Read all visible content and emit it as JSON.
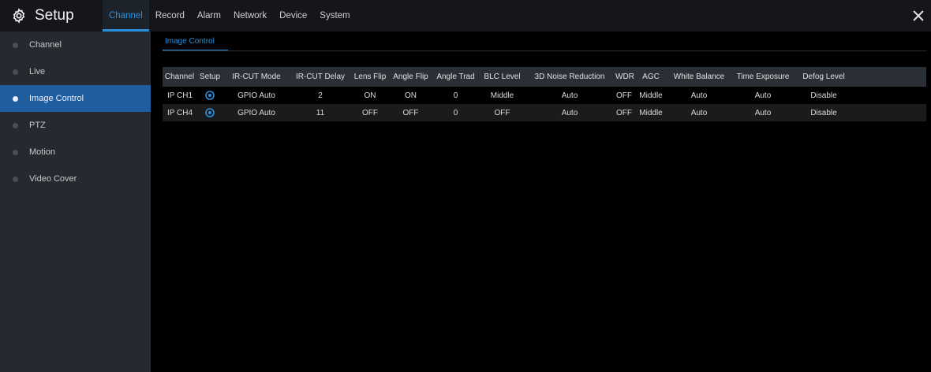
{
  "header": {
    "title": "Setup",
    "logo_icon": "gear-icon",
    "close_icon": "close-icon",
    "nav": [
      {
        "label": "Channel",
        "active": true
      },
      {
        "label": "Record"
      },
      {
        "label": "Alarm"
      },
      {
        "label": "Network"
      },
      {
        "label": "Device"
      },
      {
        "label": "System"
      }
    ]
  },
  "sidebar": {
    "items": [
      {
        "label": "Channel"
      },
      {
        "label": "Live"
      },
      {
        "label": "Image Control",
        "active": true
      },
      {
        "label": "PTZ"
      },
      {
        "label": "Motion"
      },
      {
        "label": "Video Cover"
      }
    ]
  },
  "main": {
    "tabs": [
      {
        "label": "Image Control",
        "active": true
      }
    ],
    "table": {
      "columns": [
        "Channel",
        "Setup",
        "IR-CUT Mode",
        "IR-CUT Delay",
        "Lens Flip",
        "Angle Flip",
        "Angle Trad",
        "BLC Level",
        "3D Noise Reduction",
        "WDR",
        "AGC",
        "White Balance",
        "Time Exposure",
        "Defog Level",
        ""
      ],
      "rows": [
        [
          "IP CH1",
          "",
          "GPIO Auto",
          "2",
          "ON",
          "ON",
          "0",
          "Middle",
          "Auto",
          "OFF",
          "Middle",
          "Auto",
          "Auto",
          "Disable",
          ""
        ],
        [
          "IP CH4",
          "",
          "GPIO Auto",
          "11",
          "OFF",
          "OFF",
          "0",
          "OFF",
          "Auto",
          "OFF",
          "Middle",
          "Auto",
          "Auto",
          "Disable",
          ""
        ]
      ]
    }
  },
  "colors": {
    "accent": "#2a8fdc",
    "sidebar_active": "#1f5e9e",
    "header_bg": "#14161a",
    "sidebar_bg": "#262a30",
    "table_header_bg": "#2a2f36"
  }
}
